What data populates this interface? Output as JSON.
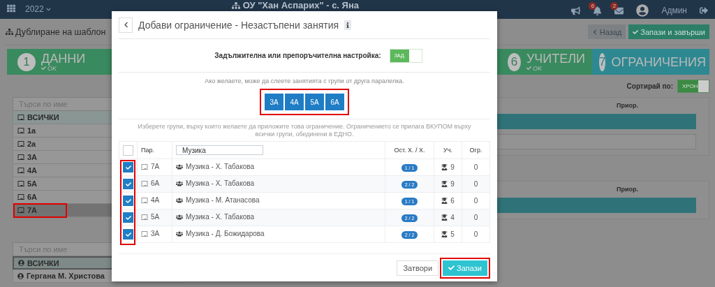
{
  "topbar": {
    "year": "2022",
    "school": "ОУ \"Хан Аспарих\" - с. Яна",
    "notifications": "6",
    "messages": "2",
    "user": "Админ"
  },
  "page": {
    "title": "Дублиране на шаблон",
    "back": "Назад",
    "save_finish": "Запази и завърши"
  },
  "steps": [
    {
      "number": "1",
      "label": "ДАННИ",
      "status": "OK",
      "done": true
    },
    {
      "number": "6",
      "label": "УЧИТЕЛИ",
      "status": "OK",
      "done": true
    },
    {
      "number": "7",
      "label": "ОГРАНИЧЕНИЯ",
      "done": false
    }
  ],
  "sort": {
    "label": "Сортирай по:",
    "toggle": "ХРОН",
    "on": true
  },
  "class_list": {
    "search_placeholder": "Търси по име",
    "items": [
      {
        "label": "ВСИЧКИ",
        "kind": "all",
        "selected": false,
        "annotated": false
      },
      {
        "label": "1а",
        "kind": "class",
        "selected": false,
        "annotated": false
      },
      {
        "label": "2а",
        "kind": "class",
        "selected": false,
        "annotated": false
      },
      {
        "label": "3А",
        "kind": "class",
        "selected": false,
        "annotated": false
      },
      {
        "label": "4А",
        "kind": "class",
        "selected": false,
        "annotated": false
      },
      {
        "label": "5А",
        "kind": "class",
        "selected": false,
        "annotated": false
      },
      {
        "label": "6А",
        "kind": "class",
        "selected": false,
        "annotated": false
      },
      {
        "label": "7А",
        "kind": "class",
        "selected": true,
        "annotated": true
      }
    ]
  },
  "teacher_list": {
    "search_placeholder": "Търси по име",
    "items": [
      {
        "label": "ВСИЧКИ",
        "kind": "all",
        "selected": true
      },
      {
        "label": "Гергана М. Христова",
        "kind": "teacher",
        "selected": false
      }
    ]
  },
  "right_panels": [
    {
      "header": "Приор."
    },
    {
      "header": "Приор."
    }
  ],
  "modal": {
    "title": "Добави ограничение - Незастъпени занятия",
    "setting_label": "Задължителна или препоръчителна настройка:",
    "setting_toggle": "ЗАД.",
    "setting_on": true,
    "merge_hint": "Ако желаете, може да слеете занятията с групи от друга паралелка.",
    "merge_groups": [
      "3А",
      "4А",
      "5А",
      "6А"
    ],
    "merge_annotated": true,
    "instruction": "Изберете групи, върху които желаете да приложите това ограничение. Ограничението се прилага ВКУПОМ върху всички групи, обединени в ЕДНО.",
    "table": {
      "all_checked": false,
      "checkbox_column_annotated": true,
      "filter_value": "Музика",
      "columns": [
        "Пар.",
        "Ост. Х. / Х.",
        "Уч.",
        "Огр."
      ],
      "rows": [
        {
          "checked": true,
          "class": "7А",
          "subject": "Музика - Х. Табакова",
          "hours": "1 / 1",
          "students": "9",
          "limits": "0"
        },
        {
          "checked": true,
          "class": "6А",
          "subject": "Музика - Х. Табакова",
          "hours": "2 / 2",
          "students": "9",
          "limits": "0"
        },
        {
          "checked": true,
          "class": "4А",
          "subject": "Музика - М. Атанасова",
          "hours": "1 / 1",
          "students": "6",
          "limits": "0"
        },
        {
          "checked": true,
          "class": "5А",
          "subject": "Музика - Х. Табакова",
          "hours": "2 / 2",
          "students": "4",
          "limits": "0"
        },
        {
          "checked": true,
          "class": "3А",
          "subject": "Музика - Д. Божидарова",
          "hours": "2 / 2",
          "students": "5",
          "limits": "0"
        }
      ]
    },
    "close": "Затвори",
    "save": "Запази",
    "save_annotated": true
  }
}
